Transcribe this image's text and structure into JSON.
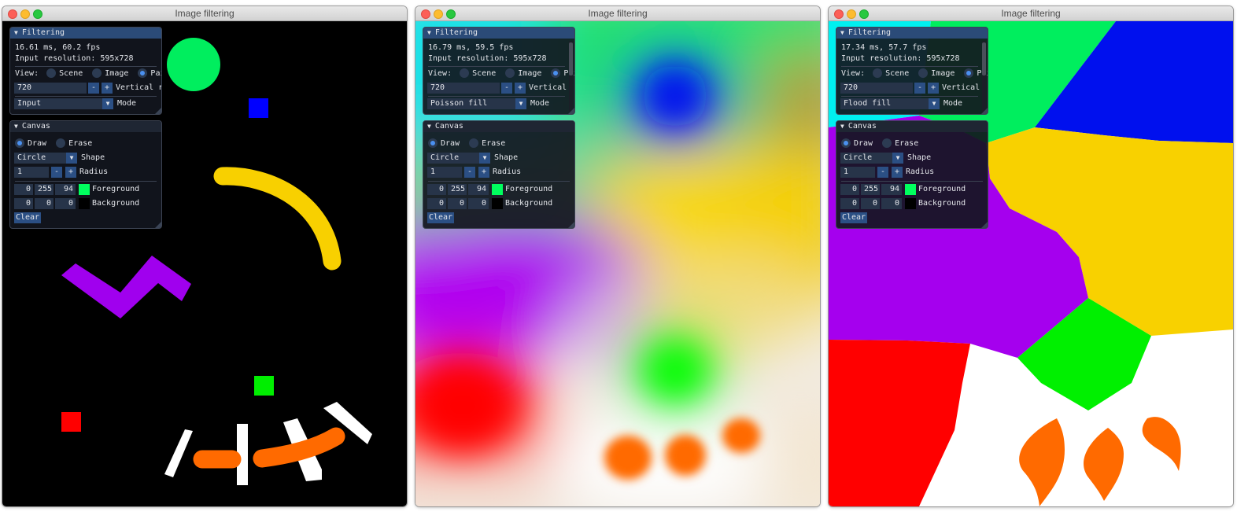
{
  "windows": [
    {
      "title": "Image filtering",
      "filtering": {
        "header": "Filtering",
        "timing": "16.61 ms, 60.2 fps",
        "resolution": "Input resolution: 595x728",
        "view_label": "View:",
        "view_options": [
          "Scene",
          "Image",
          "Paint"
        ],
        "view_selected": 2,
        "vres_value": "720",
        "minus": "-",
        "plus": "+",
        "vres_label": "Vertical r",
        "mode_value": "Input",
        "mode_label": "Mode"
      },
      "canvas": {
        "header": "Canvas",
        "draw_label": "Draw",
        "erase_label": "Erase",
        "shape_value": "Circle",
        "shape_label": "Shape",
        "radius_value": "1",
        "radius_label": "Radius",
        "fg": [
          "0",
          "255",
          "94"
        ],
        "fg_label": "Foreground",
        "fg_color": "#00ff5e",
        "bg": [
          "0",
          "0",
          "0"
        ],
        "bg_label": "Background",
        "bg_color": "#000000",
        "clear_label": "Clear"
      }
    },
    {
      "title": "Image filtering",
      "filtering": {
        "header": "Filtering",
        "timing": "16.79 ms, 59.5 fps",
        "resolution": "Input resolution: 595x728",
        "view_label": "View:",
        "view_options": [
          "Scene",
          "Image",
          "Pai"
        ],
        "view_selected": 2,
        "vres_value": "720",
        "minus": "-",
        "plus": "+",
        "vres_label": "Vertical",
        "mode_value": "Poisson fill",
        "mode_label": "Mode"
      },
      "canvas": {
        "header": "Canvas",
        "draw_label": "Draw",
        "erase_label": "Erase",
        "shape_value": "Circle",
        "shape_label": "Shape",
        "radius_value": "1",
        "radius_label": "Radius",
        "fg": [
          "0",
          "255",
          "94"
        ],
        "fg_label": "Foreground",
        "fg_color": "#00ff5e",
        "bg": [
          "0",
          "0",
          "0"
        ],
        "bg_label": "Background",
        "bg_color": "#000000",
        "clear_label": "Clear"
      }
    },
    {
      "title": "Image filtering",
      "filtering": {
        "header": "Filtering",
        "timing": "17.34 ms, 57.7 fps",
        "resolution": "Input resolution: 595x728",
        "view_label": "View:",
        "view_options": [
          "Scene",
          "Image",
          "Pai"
        ],
        "view_selected": 2,
        "vres_value": "720",
        "minus": "-",
        "plus": "+",
        "vres_label": "Vertical",
        "mode_value": "Flood fill",
        "mode_label": "Mode"
      },
      "canvas": {
        "header": "Canvas",
        "draw_label": "Draw",
        "erase_label": "Erase",
        "shape_value": "Circle",
        "shape_label": "Shape",
        "radius_value": "1",
        "radius_label": "Radius",
        "fg": [
          "0",
          "255",
          "94"
        ],
        "fg_label": "Foreground",
        "fg_color": "#00ff5e",
        "bg": [
          "0",
          "0",
          "0"
        ],
        "bg_label": "Background",
        "bg_color": "#000000",
        "clear_label": "Clear"
      }
    }
  ],
  "icons": {
    "collapse": "triangle-down-icon",
    "combo_arrow": "triangle-down-icon"
  }
}
